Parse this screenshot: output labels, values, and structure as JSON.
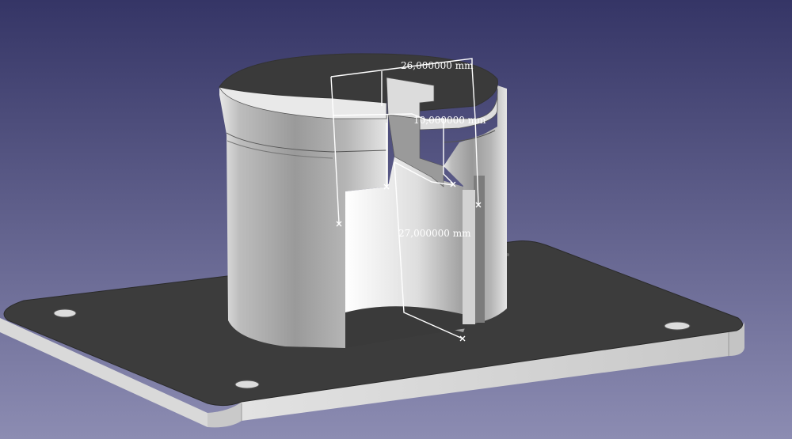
{
  "viewport": {
    "background_top": "#353566",
    "background_bottom": "#8a8ab0"
  },
  "model": {
    "base_plate_top": "#3b3b3b",
    "base_plate_edge": "#d6d6d6",
    "cylinder_light": "#f0f0f0",
    "cylinder_dark": "#7a7a7a",
    "top_face": "#3a3a3a",
    "sketch_line": "#ffffff"
  },
  "dimensions": [
    {
      "label": "26,000000 mm"
    },
    {
      "label": "10,000000 mm"
    },
    {
      "label": "27,000000 mm"
    }
  ]
}
